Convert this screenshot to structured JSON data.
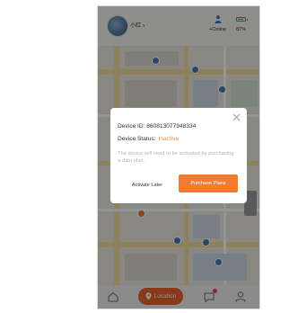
{
  "header": {
    "device_name": "小红",
    "online_status": "+Online",
    "battery": "87%",
    "battery_level": 0.87
  },
  "modal": {
    "device_id_label": "Device ID:",
    "device_id_value": "860813077948334",
    "device_status_label": "Device Status:",
    "device_status_value": "Inactive",
    "note": "The device will need to be activated by purchasing a data plan.",
    "activate_later_label": "Activate Later",
    "purchase_plans_label": "Purchase Plans"
  },
  "bottom_nav": {
    "location_label": "Location"
  },
  "colors": {
    "accent": "#f27b2e",
    "status_inactive": "#f08b3c",
    "location_pill": "#e8622d",
    "battery": "#3aa65a"
  },
  "icons": {
    "close": "close-icon",
    "home": "home-icon",
    "location": "location-pin-icon",
    "chat": "chat-icon",
    "profile": "profile-icon",
    "person": "person-icon",
    "battery": "battery-icon"
  }
}
